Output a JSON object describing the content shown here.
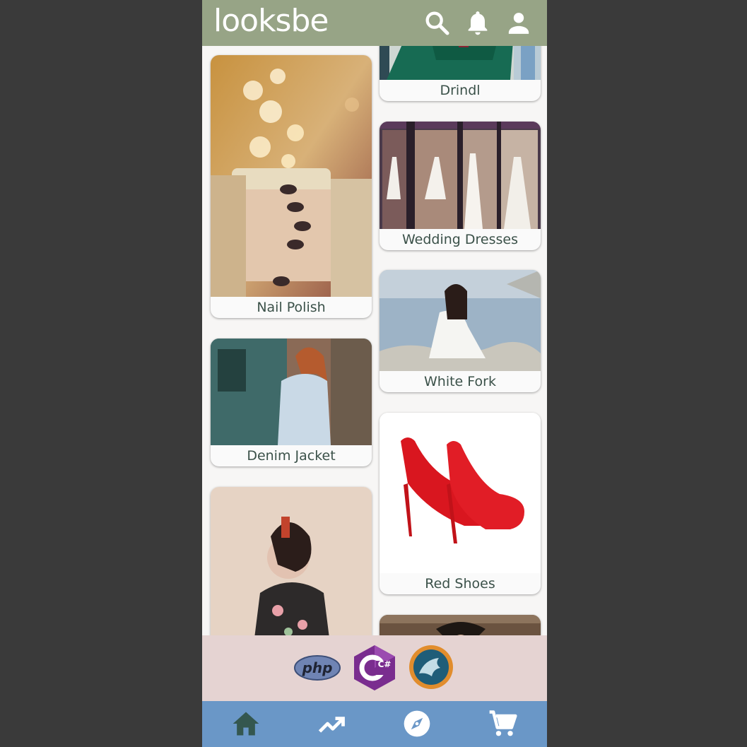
{
  "app": {
    "brand": "looksbe"
  },
  "header": {
    "icons": [
      "search-icon",
      "bell-icon",
      "user-icon"
    ]
  },
  "feed": {
    "items": [
      {
        "label": "Drindl",
        "column": "right"
      },
      {
        "label": "Nail Polish",
        "column": "left"
      },
      {
        "label": "Wedding Dresses",
        "column": "right"
      },
      {
        "label": "White Fork",
        "column": "right"
      },
      {
        "label": "Denim Jacket",
        "column": "left"
      },
      {
        "label": "Red Shoes",
        "column": "right"
      }
    ]
  },
  "banner": {
    "logos": [
      {
        "name": "php-logo",
        "text": "php"
      },
      {
        "name": "csharp-logo",
        "text": "C#"
      },
      {
        "name": "mysql-logo",
        "text": ""
      }
    ]
  },
  "bottom_nav": {
    "icons": [
      "home-icon",
      "trending-icon",
      "explore-icon",
      "cart-icon"
    ]
  },
  "colors": {
    "header": "#97a486",
    "banner": "#e5d3d2",
    "nav": "#6a97c7",
    "nav_icon": "#34574f",
    "label_text": "#3b5149"
  }
}
